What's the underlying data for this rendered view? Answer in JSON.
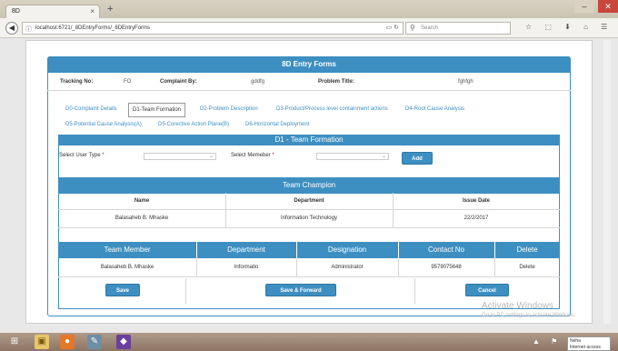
{
  "browser": {
    "tab_title": "8D",
    "tab_close": "×",
    "new_tab": "+",
    "url": "localhost:6721/_8DEntryForms/_8DEntryForms",
    "search_placeholder": "Search",
    "window_controls": {
      "minimize": "–",
      "maximize": "□",
      "close": "✕"
    }
  },
  "form": {
    "title": "8D Entry Forms",
    "tracking_no_label": "Tracking No:",
    "tracking_no_value": "FO",
    "complaint_by_label": "Complaint By:",
    "complaint_by_value": "gddfg",
    "problem_title_label": "Problem Title:",
    "problem_title_value": "fghfgh"
  },
  "tabs": [
    {
      "label": "D0-Complaint Details"
    },
    {
      "label": "D1-Team Formation",
      "active": true
    },
    {
      "label": "D2-Problem Description"
    },
    {
      "label": "D3-Product/Process level containment actions"
    },
    {
      "label": "D4-Root Cause Analysis"
    },
    {
      "label": "D5-Potential Cause Analysis(A)"
    },
    {
      "label": "D5-Corective Action Plane(B)"
    },
    {
      "label": "D6-Horizontal Deployment"
    }
  ],
  "d1": {
    "title": "D1 - Team Formation",
    "user_type_label": "Select User Type",
    "member_label": "Select Memeber",
    "required_mark": "*",
    "add_label": "Add"
  },
  "champion": {
    "title": "Team Champion",
    "columns": [
      "Name",
      "Department",
      "Issue Date"
    ],
    "rows": [
      [
        "Balasaheb B. Mhaske",
        "Information Technology",
        "22/2/2017"
      ]
    ]
  },
  "members": {
    "columns": [
      "Team Member",
      "Department",
      "Designation",
      "Contact No",
      "Delete"
    ],
    "rows": [
      [
        "Balasaheb B. Mhaske",
        "Informatio",
        "Administrator",
        "9579075648",
        "Delete"
      ]
    ]
  },
  "actions": {
    "save": "Save",
    "save_forward": "Save & Forward",
    "cancel": "Cancel"
  },
  "os": {
    "watermark_title": "Activate Windows",
    "watermark_sub": "Go to PC settings to activate Windows.",
    "notif_user": "Neha",
    "notif_text": "Internet access"
  }
}
